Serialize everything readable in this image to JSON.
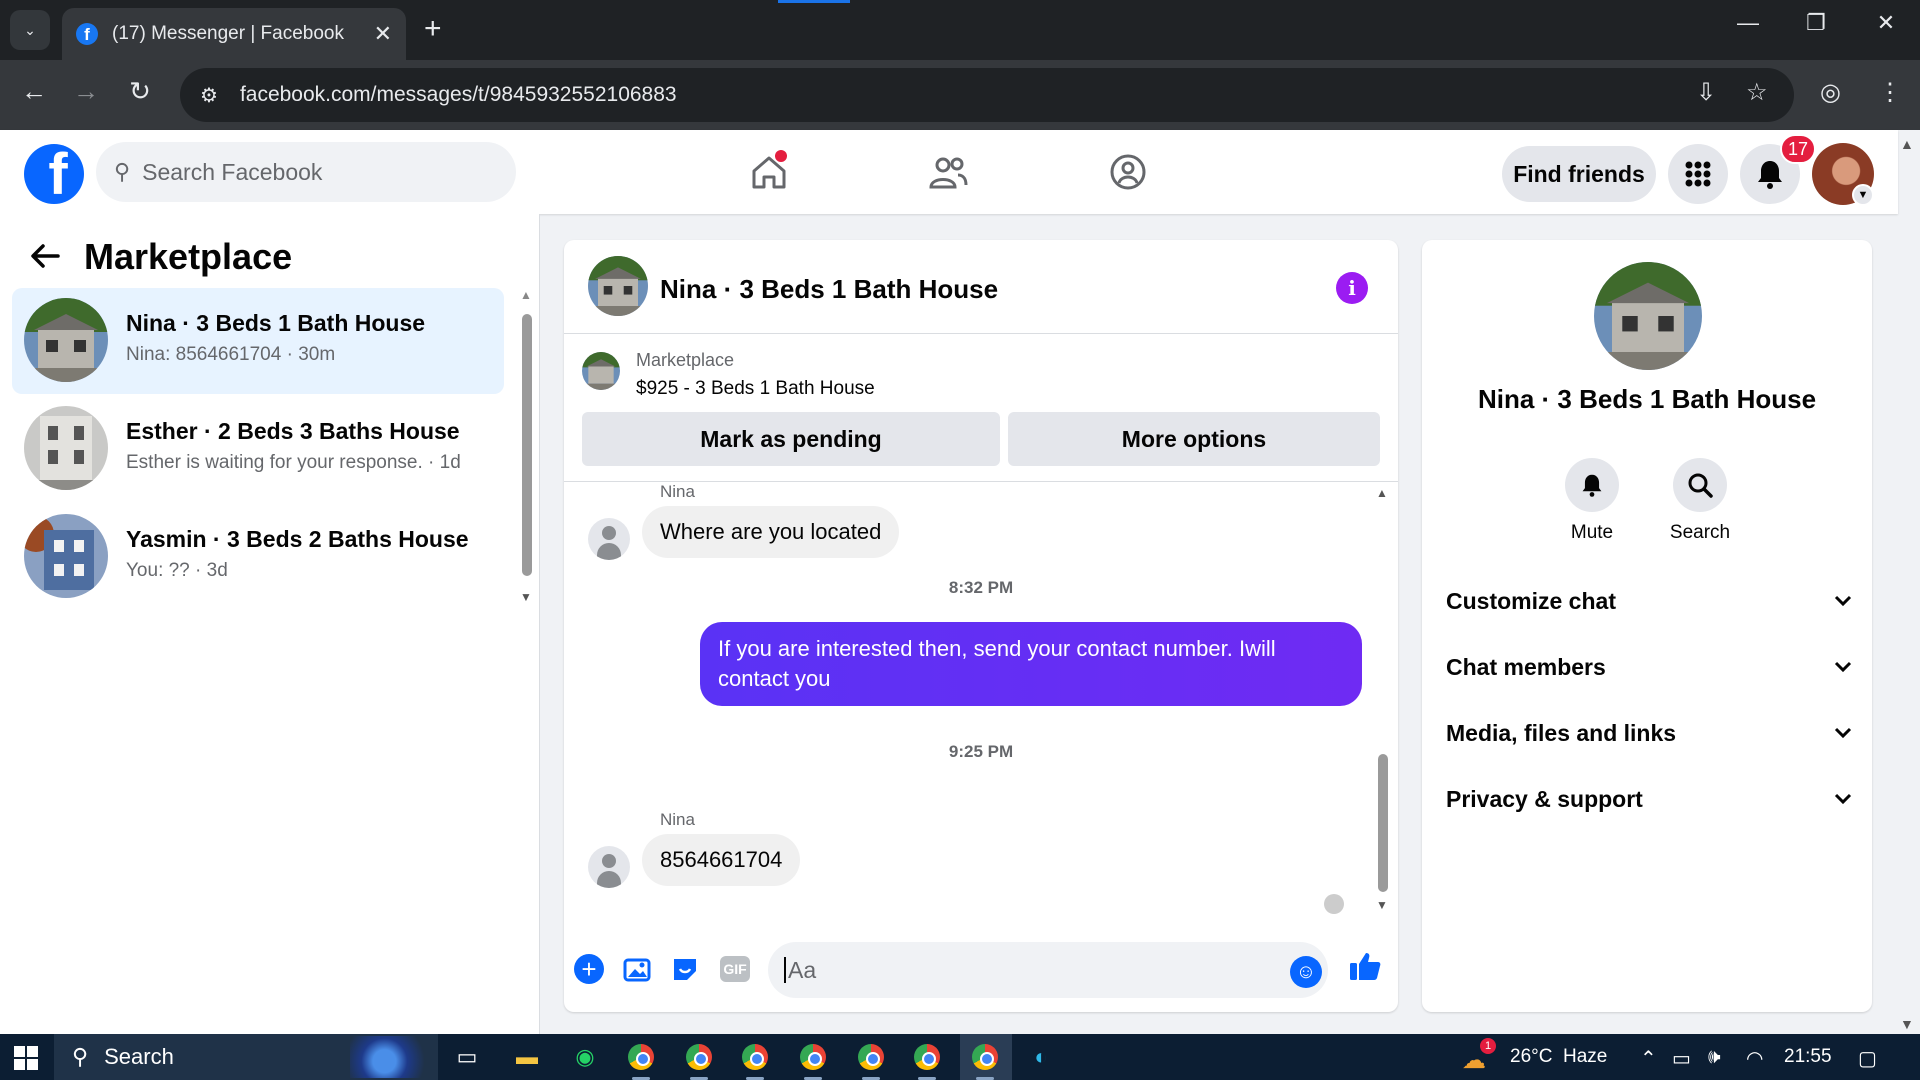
{
  "browser": {
    "tab_title": "(17) Messenger | Facebook",
    "url": "facebook.com/messages/t/9845932552106883"
  },
  "fb_header": {
    "search_placeholder": "Search Facebook",
    "find_friends_label": "Find friends",
    "notification_count": "17"
  },
  "sidebar": {
    "title": "Marketplace",
    "conversations": [
      {
        "title": "Nina · 3 Beds 1 Bath House",
        "subtitle": "Nina: 8564661704 · 30m",
        "active": true
      },
      {
        "title": "Esther · 2 Beds 3 Baths House",
        "subtitle": "Esther is waiting for your response. · 1d",
        "active": false
      },
      {
        "title": "Yasmin · 3 Beds 2 Baths House",
        "subtitle": "You: ?? · 3d",
        "active": false
      }
    ]
  },
  "chat": {
    "title": "Nina · 3 Beds 1 Bath House",
    "listing": {
      "category": "Marketplace",
      "price_title": "$925 - 3 Beds 1 Bath House",
      "mark_pending_label": "Mark as pending",
      "more_options_label": "More options"
    },
    "messages": [
      {
        "sender": "Nina",
        "text": "Where are you located",
        "direction": "in"
      },
      {
        "timestamp": "8:32 PM"
      },
      {
        "text": "If you are interested then, send your contact number. Iwill contact you",
        "direction": "out"
      },
      {
        "timestamp": "9:25 PM"
      },
      {
        "sender": "Nina",
        "text": "8564661704",
        "direction": "in"
      }
    ],
    "composer_placeholder": "Aa"
  },
  "details_panel": {
    "title": "Nina · 3 Beds 1 Bath House",
    "actions": [
      {
        "label": "Mute",
        "icon": "bell-icon"
      },
      {
        "label": "Search",
        "icon": "search-icon"
      }
    ],
    "sections": [
      "Customize chat",
      "Chat members",
      "Media, files and links",
      "Privacy & support"
    ]
  },
  "taskbar": {
    "search_label": "Search",
    "weather": "26°C  Haze",
    "weather_badge": "1",
    "time": "21:55"
  },
  "colors": {
    "fb_blue": "#0866ff",
    "outgoing_bubble": "#5a32f5",
    "info_purple": "#9b1cf2",
    "active_conversation": "#e7f3ff"
  }
}
